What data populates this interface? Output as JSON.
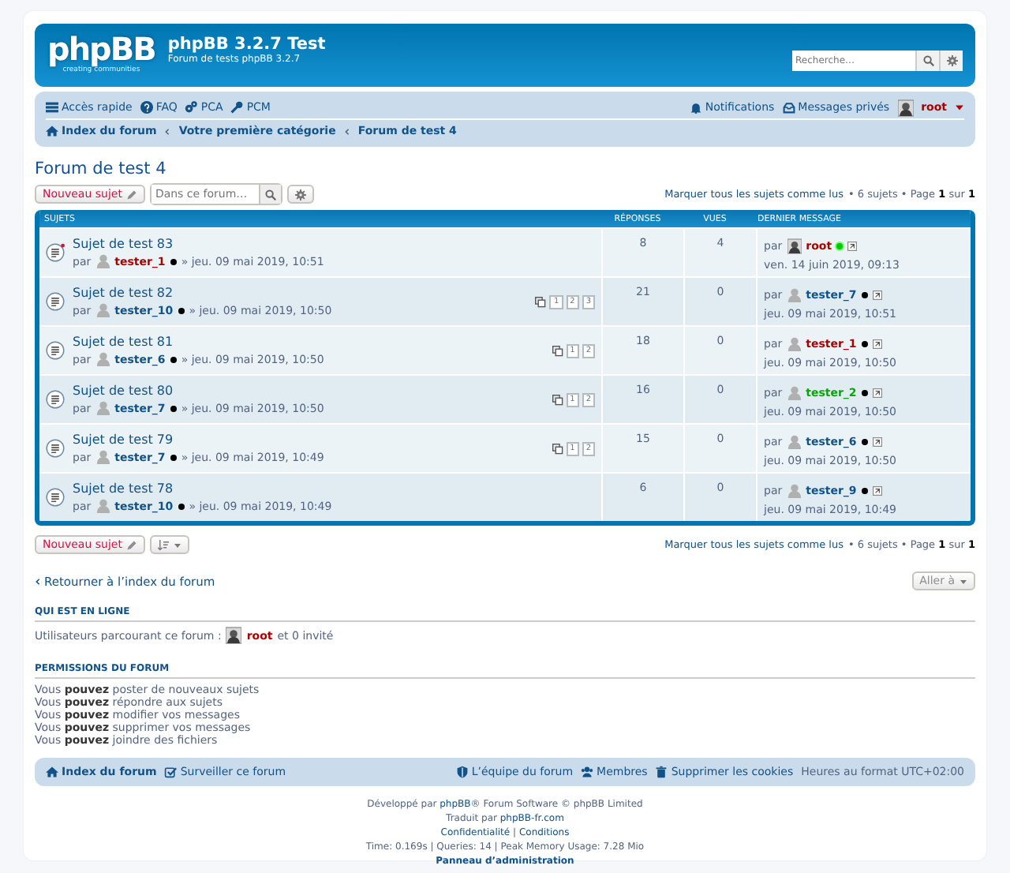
{
  "header": {
    "logo": {
      "name": "phpBB",
      "tagline": "creating communities"
    },
    "site_title": "phpBB 3.2.7 Test",
    "site_description": "Forum de tests phpBB 3.2.7",
    "search": {
      "placeholder": "Recherche…"
    }
  },
  "navbar": {
    "links": [
      {
        "label": "Accès rapide"
      },
      {
        "label": "FAQ"
      },
      {
        "label": "PCA"
      },
      {
        "label": "PCM"
      }
    ],
    "user_links": [
      {
        "label": "Notifications"
      },
      {
        "label": "Messages privés"
      }
    ],
    "user": {
      "name": "root",
      "color": "#aa0000"
    },
    "breadcrumbs": [
      {
        "label": "Index du forum"
      },
      {
        "label": "Votre première catégorie"
      },
      {
        "label": "Forum de test 4"
      }
    ]
  },
  "forum_title": "Forum de test 4",
  "actions": {
    "new_topic": "Nouveau sujet",
    "search_placeholder": "Dans ce forum…"
  },
  "pagination_top": {
    "mark_read": "Marquer tous les sujets comme lus",
    "summary": "• 6 sujets • Page **1** sur **1**"
  },
  "table": {
    "columns": [
      "SUJETS",
      "RÉPONSES",
      "VUES",
      "DERNIER MESSAGE"
    ],
    "rows": [
      {
        "title": "Sujet de test 83",
        "unread": true,
        "by": "par",
        "author": {
          "name": "tester_1",
          "color": "#aa0000",
          "online": false
        },
        "date": "» jeu. 09 mai 2019, 10:51",
        "pages": [],
        "replies": "8",
        "views": "4",
        "last": {
          "by": "par",
          "has_avatar": true,
          "name": "root",
          "color": "#aa0000",
          "online": true,
          "date": "ven. 14 juin 2019, 09:13"
        }
      },
      {
        "title": "Sujet de test 82",
        "unread": false,
        "by": "par",
        "author": {
          "name": "tester_10",
          "color": "#105289",
          "online": false
        },
        "date": "» jeu. 09 mai 2019, 10:50",
        "pages": [
          "1",
          "2",
          "3"
        ],
        "replies": "21",
        "views": "0",
        "last": {
          "by": "par",
          "has_avatar": false,
          "name": "tester_7",
          "color": "#105289",
          "online": false,
          "date": "jeu. 09 mai 2019, 10:51"
        }
      },
      {
        "title": "Sujet de test 81",
        "unread": false,
        "by": "par",
        "author": {
          "name": "tester_6",
          "color": "#105289",
          "online": false
        },
        "date": "» jeu. 09 mai 2019, 10:50",
        "pages": [
          "1",
          "2"
        ],
        "replies": "18",
        "views": "0",
        "last": {
          "by": "par",
          "has_avatar": false,
          "name": "tester_1",
          "color": "#aa0000",
          "online": false,
          "date": "jeu. 09 mai 2019, 10:50"
        }
      },
      {
        "title": "Sujet de test 80",
        "unread": false,
        "by": "par",
        "author": {
          "name": "tester_7",
          "color": "#105289",
          "online": false
        },
        "date": "» jeu. 09 mai 2019, 10:50",
        "pages": [
          "1",
          "2"
        ],
        "replies": "16",
        "views": "0",
        "last": {
          "by": "par",
          "has_avatar": false,
          "name": "tester_2",
          "color": "#00aa00",
          "online": false,
          "date": "jeu. 09 mai 2019, 10:50"
        }
      },
      {
        "title": "Sujet de test 79",
        "unread": false,
        "by": "par",
        "author": {
          "name": "tester_7",
          "color": "#105289",
          "online": false
        },
        "date": "» jeu. 09 mai 2019, 10:49",
        "pages": [
          "1",
          "2"
        ],
        "replies": "15",
        "views": "0",
        "last": {
          "by": "par",
          "has_avatar": false,
          "name": "tester_6",
          "color": "#105289",
          "online": false,
          "date": "jeu. 09 mai 2019, 10:50"
        }
      },
      {
        "title": "Sujet de test 78",
        "unread": false,
        "by": "par",
        "author": {
          "name": "tester_10",
          "color": "#105289",
          "online": false
        },
        "date": "» jeu. 09 mai 2019, 10:49",
        "pages": [],
        "replies": "6",
        "views": "0",
        "last": {
          "by": "par",
          "has_avatar": false,
          "name": "tester_9",
          "color": "#105289",
          "online": false,
          "date": "jeu. 09 mai 2019, 10:49"
        }
      }
    ]
  },
  "actions_bottom": {
    "new_topic": "Nouveau sujet"
  },
  "pagination_bottom": {
    "mark_read": "Marquer tous les sujets comme lus",
    "summary": "• 6 sujets • Page **1** sur **1**"
  },
  "jump": {
    "back": "Retourner à l’index du forum",
    "jump_to": "Aller à"
  },
  "online": {
    "title": "QUI EST EN LIGNE",
    "label": "Utilisateurs parcourant ce forum :",
    "user": {
      "name": "root",
      "color": "#aa0000"
    },
    "rest": "et 0 invité"
  },
  "permissions": {
    "title": "PERMISSIONS DU FORUM",
    "lines": [
      "Vous **pouvez** poster de nouveaux sujets",
      "Vous **pouvez** répondre aux sujets",
      "Vous **pouvez** modifier vos messages",
      "Vous **pouvez** supprimer vos messages",
      "Vous **pouvez** joindre des fichiers"
    ]
  },
  "footer_nav": {
    "left": [
      {
        "label": "Index du forum"
      },
      {
        "label": "Surveiller ce forum"
      }
    ],
    "right": [
      {
        "label": "L’équipe du forum"
      },
      {
        "label": "Membres"
      },
      {
        "label": "Supprimer les cookies"
      }
    ],
    "timezone": "Heures au format UTC+02:00"
  },
  "credits": {
    "powered": [
      {
        "kind": "text",
        "text": "Développé par "
      },
      {
        "kind": "link",
        "text": "phpBB"
      },
      {
        "kind": "text",
        "text": "® Forum Software © phpBB Limited"
      }
    ],
    "translated": [
      {
        "kind": "text",
        "text": "Traduit par "
      },
      {
        "kind": "link",
        "text": "phpBB-fr.com"
      }
    ],
    "legal": [
      {
        "kind": "link",
        "text": "Confidentialité"
      },
      {
        "kind": "text",
        "text": " | "
      },
      {
        "kind": "link",
        "text": "Conditions"
      }
    ],
    "stats": "Time: 0.169s | Queries: 14 | Peak Memory Usage: 7.28 Mio",
    "admin": "Panneau d’administration"
  }
}
